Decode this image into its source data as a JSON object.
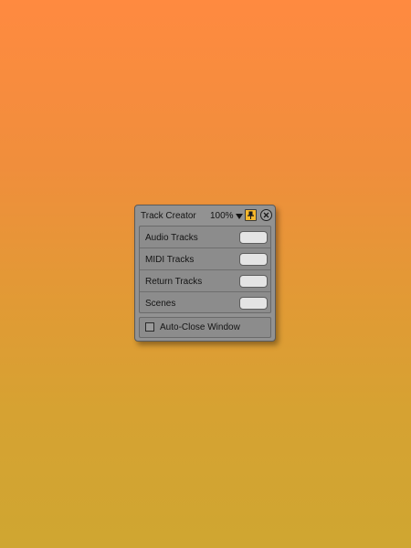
{
  "window": {
    "title": "Track Creator",
    "zoom": "100%",
    "pin_icon": "pin-icon",
    "close_icon": "close-icon"
  },
  "tracks": [
    {
      "label": "Audio Tracks",
      "value": ""
    },
    {
      "label": "MIDI Tracks",
      "value": ""
    },
    {
      "label": "Return Tracks",
      "value": ""
    },
    {
      "label": "Scenes",
      "value": ""
    }
  ],
  "options": {
    "auto_close_label": "Auto-Close Window",
    "auto_close_checked": false
  },
  "colors": {
    "background_top": "#ff8a40",
    "background_bottom": "#cfa631",
    "window_bg": "#929292",
    "pin_active": "#f5b72c",
    "field_bg": "#e4e4e4"
  }
}
